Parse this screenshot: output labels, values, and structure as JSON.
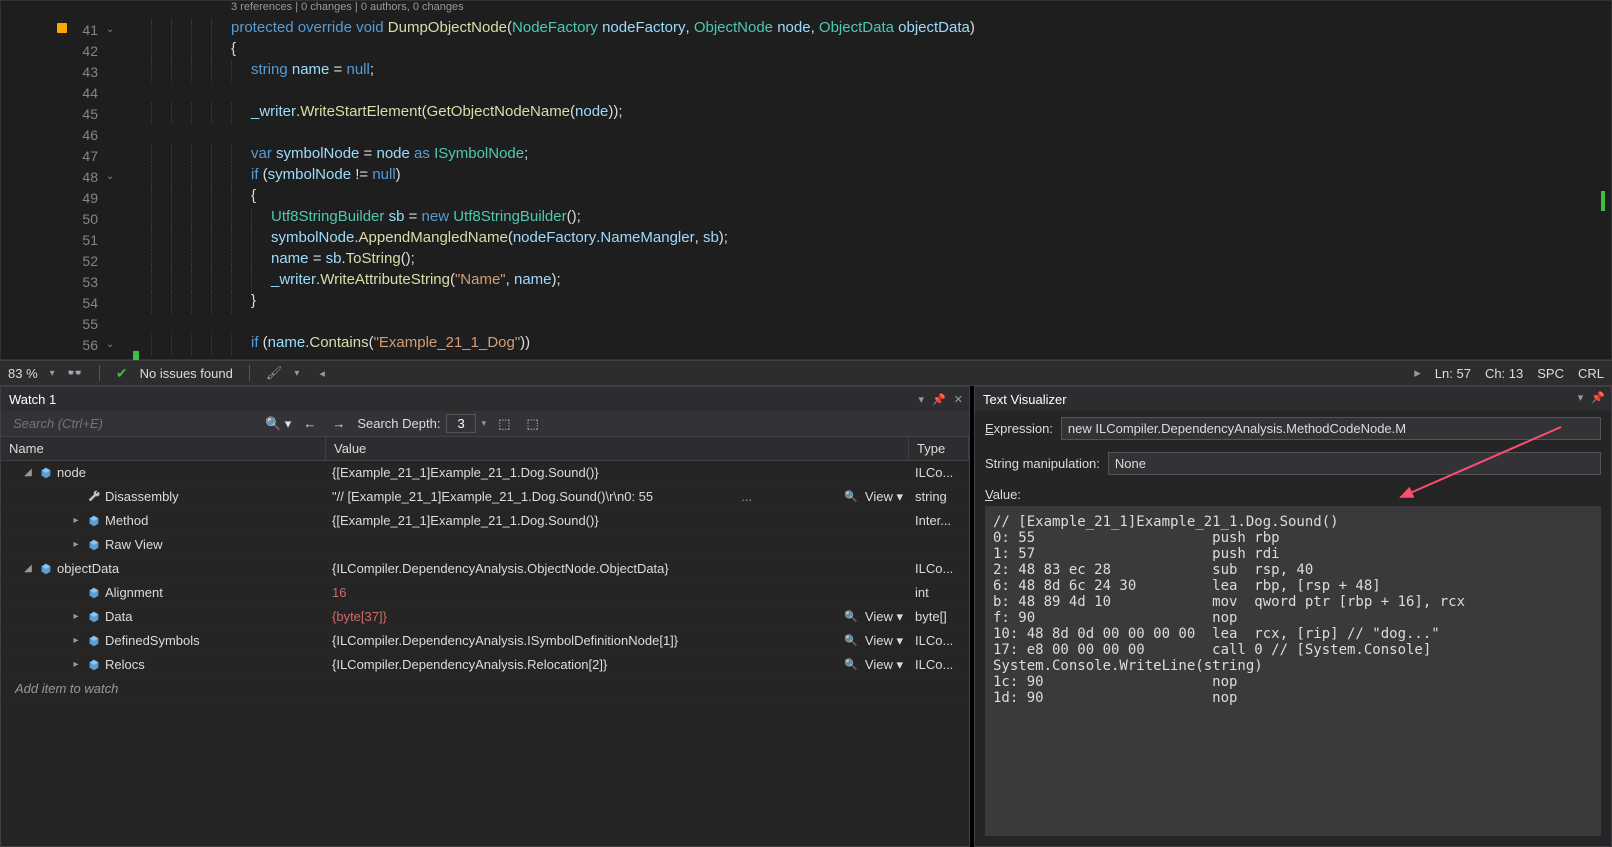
{
  "editor": {
    "codelens": "3 references | 0 changes | 0 authors, 0 changes",
    "lines": [
      {
        "n": "41",
        "fold": "⌄"
      },
      {
        "n": "42"
      },
      {
        "n": "43"
      },
      {
        "n": "44"
      },
      {
        "n": "45"
      },
      {
        "n": "46"
      },
      {
        "n": "47"
      },
      {
        "n": "48",
        "fold": "⌄"
      },
      {
        "n": "49"
      },
      {
        "n": "50"
      },
      {
        "n": "51"
      },
      {
        "n": "52"
      },
      {
        "n": "53"
      },
      {
        "n": "54"
      },
      {
        "n": "55"
      },
      {
        "n": "56",
        "fold": "⌄"
      }
    ],
    "code": {
      "l41_protected": "protected",
      "l41_override": "override",
      "l41_void": "void",
      "l41_method": "DumpObjectNode",
      "l41_p1t": "NodeFactory",
      "l41_p1": "nodeFactory",
      "l41_p2t": "ObjectNode",
      "l41_p2": "node",
      "l41_p3t": "ObjectData",
      "l41_p3": "objectData",
      "l42": "{",
      "l43_kw": "string",
      "l43_name": "name",
      "l43_eq": " = ",
      "l43_null": "null",
      "l43_sc": ";",
      "l45_a": "_writer",
      "l45_b": ".",
      "l45_c": "WriteStartElement",
      "l45_d": "(",
      "l45_e": "GetObjectNodeName",
      "l45_f": "(",
      "l45_g": "node",
      "l45_h": "));",
      "l47_var": "var",
      "l47_sn": "symbolNode",
      "l47_eq": " = ",
      "l47_node": "node",
      "l47_as": " as ",
      "l47_type": "ISymbolNode",
      "l47_sc": ";",
      "l48_if": "if",
      "l48_op": " (",
      "l48_sn": "symbolNode",
      "l48_ne": " != ",
      "l48_null": "null",
      "l48_cp": ")",
      "l49": "{",
      "l50_t": "Utf8StringBuilder",
      "l50_sb": "sb",
      "l50_eq": " = ",
      "l50_new": "new",
      "l50_t2": "Utf8StringBuilder",
      "l50_p": "();",
      "l51_a": "symbolNode",
      "l51_b": ".",
      "l51_c": "AppendMangledName",
      "l51_d": "(",
      "l51_e": "nodeFactory",
      "l51_f": ".",
      "l51_g": "NameMangler",
      "l51_h": ", ",
      "l51_i": "sb",
      "l51_j": ");",
      "l52_a": "name",
      "l52_b": " = ",
      "l52_c": "sb",
      "l52_d": ".",
      "l52_e": "ToString",
      "l52_f": "();",
      "l53_a": "_writer",
      "l53_b": ".",
      "l53_c": "WriteAttributeString",
      "l53_d": "(",
      "l53_e": "\"Name\"",
      "l53_f": ", ",
      "l53_g": "name",
      "l53_h": ");",
      "l54": "}",
      "l56_if": "if",
      "l56_op": " (",
      "l56_name": "name",
      "l56_d": ".",
      "l56_c": "Contains",
      "l56_op2": "(",
      "l56_s": "\"Example_21_1_Dog\"",
      "l56_cp": "))"
    }
  },
  "statusbar": {
    "zoom": "83 %",
    "issues": "No issues found",
    "ln": "Ln: 57",
    "ch": "Ch: 13",
    "spc": "SPC",
    "crlf": "CRL"
  },
  "watch": {
    "title": "Watch 1",
    "search_placeholder": "Search (Ctrl+E)",
    "depth_label": "Search Depth:",
    "depth_value": "3",
    "col_name": "Name",
    "col_value": "Value",
    "col_type": "Type",
    "rows": [
      {
        "exp": "◢",
        "icon": "obj",
        "name": "node",
        "value": "{[Example_21_1]Example_21_1.Dog.Sound()}",
        "type": "ILCo...",
        "indent": 0
      },
      {
        "exp": "",
        "icon": "wrench",
        "name": "Disassembly",
        "value": "\"// [Example_21_1]Example_21_1.Dog.Sound()\\r\\n0: 55",
        "view": "View",
        "dots": "...",
        "lens": true,
        "type": "string",
        "indent": 1
      },
      {
        "exp": "▸",
        "icon": "obj",
        "name": "Method",
        "value": "{[Example_21_1]Example_21_1.Dog.Sound()}",
        "type": "Inter...",
        "indent": 1
      },
      {
        "exp": "▸",
        "icon": "obj",
        "name": "Raw View",
        "value": "",
        "type": "",
        "indent": 1
      },
      {
        "exp": "◢",
        "icon": "obj",
        "name": "objectData",
        "value": "{ILCompiler.DependencyAnalysis.ObjectNode.ObjectData}",
        "type": "ILCo...",
        "indent": 0
      },
      {
        "exp": "",
        "icon": "obj",
        "name": "Alignment",
        "value": "16",
        "red": true,
        "type": "int",
        "indent": 1
      },
      {
        "exp": "▸",
        "icon": "obj",
        "name": "Data",
        "value": "{byte[37]}",
        "red": true,
        "view": "View",
        "lens": true,
        "type": "byte[]",
        "indent": 1
      },
      {
        "exp": "▸",
        "icon": "obj",
        "name": "DefinedSymbols",
        "value": "{ILCompiler.DependencyAnalysis.ISymbolDefinitionNode[1]}",
        "view": "View",
        "lens": true,
        "type": "ILCo...",
        "indent": 1
      },
      {
        "exp": "▸",
        "icon": "obj",
        "name": "Relocs",
        "value": "{ILCompiler.DependencyAnalysis.Relocation[2]}",
        "view": "View",
        "lens": true,
        "type": "ILCo...",
        "indent": 1
      }
    ],
    "add_item": "Add item to watch"
  },
  "textvis": {
    "title": "Text Visualizer",
    "expr_label": "Expression:",
    "expr_value": "new ILCompiler.DependencyAnalysis.MethodCodeNode.M",
    "manip_label": "String manipulation:",
    "manip_value": "None",
    "value_label": "Value:",
    "body": "// [Example_21_1]Example_21_1.Dog.Sound()\n0: 55                     push rbp\n1: 57                     push rdi\n2: 48 83 ec 28            sub  rsp, 40\n6: 48 8d 6c 24 30         lea  rbp, [rsp + 48]\nb: 48 89 4d 10            mov  qword ptr [rbp + 16], rcx\nf: 90                     nop\n10: 48 8d 0d 00 00 00 00  lea  rcx, [rip] // \"dog...\"\n17: e8 00 00 00 00        call 0 // [System.Console]\nSystem.Console.WriteLine(string)\n1c: 90                    nop\n1d: 90                    nop"
  }
}
